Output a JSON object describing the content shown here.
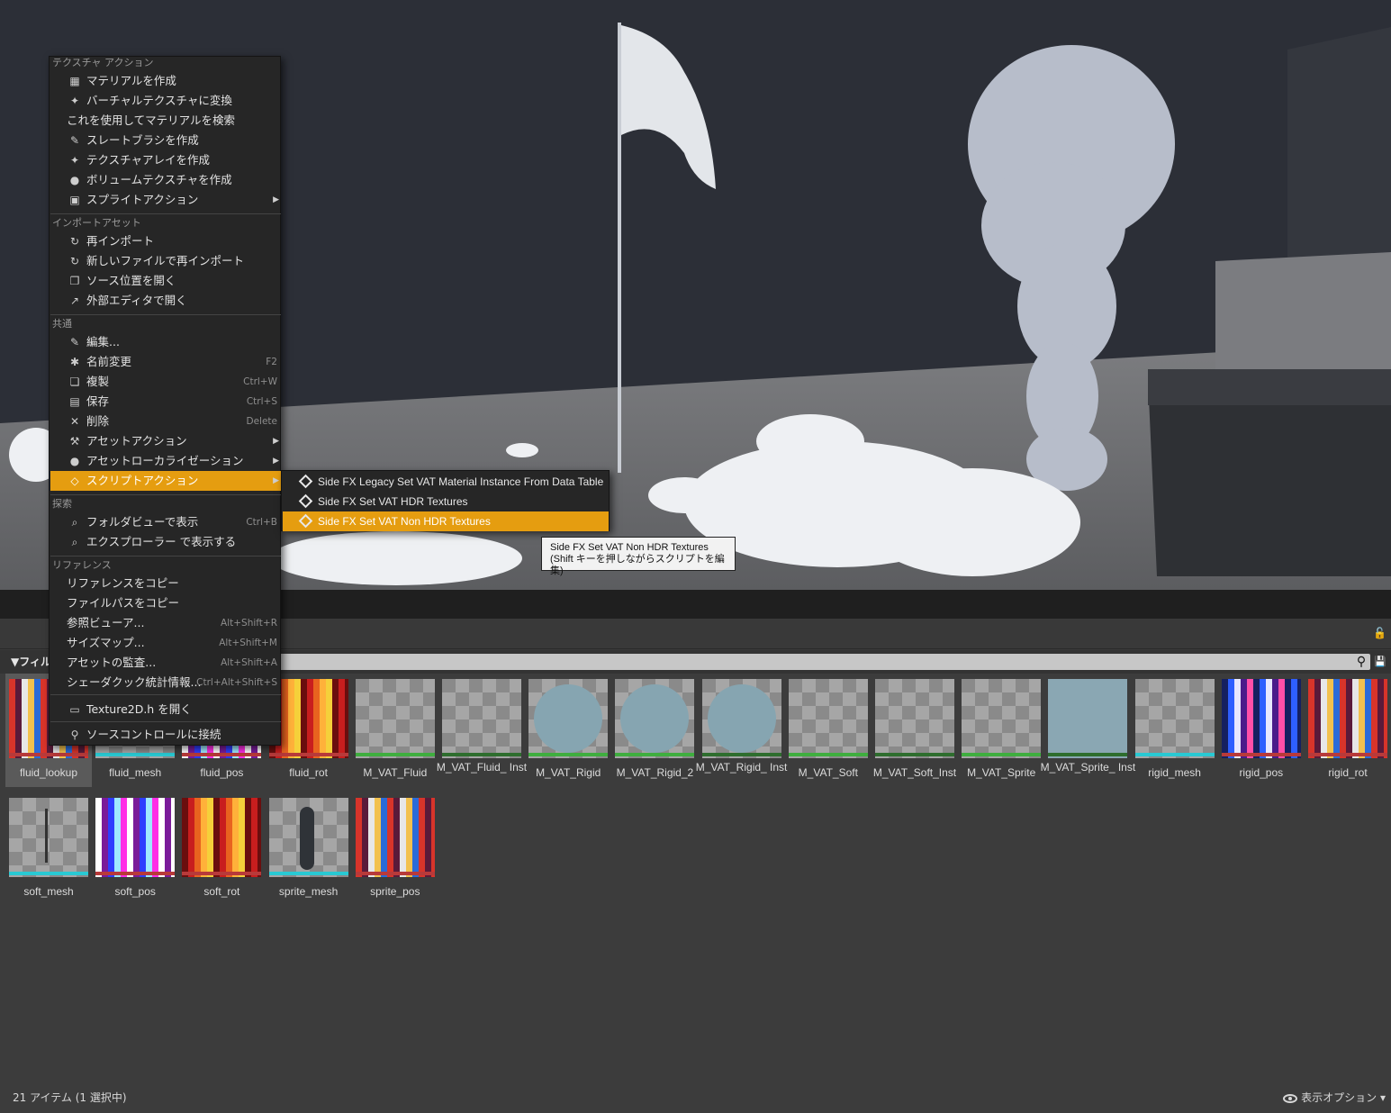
{
  "context_menu": {
    "sections": {
      "texture_actions": "テクスチャ アクション",
      "import_asset": "インポートアセット",
      "common": "共通",
      "explore": "探索",
      "reference": "リファレンス"
    },
    "items": [
      {
        "label": "マテリアルを作成",
        "icon": "material-icon"
      },
      {
        "label": "バーチャルテクスチャに変換",
        "icon": "virtual-texture-icon"
      },
      {
        "label": "これを使用してマテリアルを検索"
      },
      {
        "label": "スレートブラシを作成",
        "icon": "brush-icon"
      },
      {
        "label": "テクスチャアレイを作成",
        "icon": "texture-array-icon"
      },
      {
        "label": "ボリュームテクスチャを作成",
        "icon": "sphere-icon"
      },
      {
        "label": "スプライトアクション",
        "icon": "sprite-icon",
        "submenu": true
      },
      {
        "label": "再インポート",
        "icon": "reimport-icon"
      },
      {
        "label": "新しいファイルで再インポート",
        "icon": "reimport-icon"
      },
      {
        "label": "ソース位置を開く",
        "icon": "folder-open-icon"
      },
      {
        "label": "外部エディタで開く",
        "icon": "external-editor-icon"
      },
      {
        "label": "編集...",
        "icon": "edit-icon"
      },
      {
        "label": "名前変更",
        "icon": "rename-icon",
        "shortcut": "F2"
      },
      {
        "label": "複製",
        "icon": "duplicate-icon",
        "shortcut": "Ctrl+W"
      },
      {
        "label": "保存",
        "icon": "save-icon",
        "shortcut": "Ctrl+S"
      },
      {
        "label": "削除",
        "icon": "delete-icon",
        "shortcut": "Delete"
      },
      {
        "label": "アセットアクション",
        "icon": "wrench-icon",
        "submenu": true
      },
      {
        "label": "アセットローカライゼーション",
        "icon": "globe-icon",
        "submenu": true
      },
      {
        "label": "スクリプトアクション",
        "icon": "script-icon",
        "submenu": true,
        "highlighted": true
      },
      {
        "label": "フォルダビューで表示",
        "icon": "magnifier-icon",
        "shortcut": "Ctrl+B"
      },
      {
        "label": "エクスプローラー で表示する",
        "icon": "magnifier-icon"
      },
      {
        "label": "リファレンスをコピー"
      },
      {
        "label": "ファイルパスをコピー"
      },
      {
        "label": "参照ビューア...",
        "shortcut": "Alt+Shift+R"
      },
      {
        "label": "サイズマップ...",
        "shortcut": "Alt+Shift+M"
      },
      {
        "label": "アセットの監査...",
        "shortcut": "Alt+Shift+A"
      },
      {
        "label": "シェーダクック統計情報...",
        "shortcut": "Ctrl+Alt+Shift+S"
      },
      {
        "label": "Texture2D.h を開く",
        "icon": "code-icon"
      },
      {
        "label": "ソースコントロールに接続",
        "icon": "source-control-icon"
      }
    ]
  },
  "submenu": {
    "items": [
      {
        "label": "Side FX Legacy Set VAT Material Instance From Data Table"
      },
      {
        "label": "Side FX Set VAT HDR Textures"
      },
      {
        "label": "Side FX Set VAT Non HDR Textures",
        "highlighted": true
      }
    ]
  },
  "tooltip": {
    "line1": "Side FX Set VAT Non HDR Textures",
    "line2": "(Shift キーを押しながらスクリプトを編集)"
  },
  "content_browser": {
    "filter_label": "▼フィル",
    "search_placeholder": "",
    "status": "21 アイテム (1 選択中)",
    "view_options": "表示オプション",
    "assets": [
      {
        "name": "fluid_lookup",
        "kind": "texture",
        "bar": "#b83a3a",
        "selected": true
      },
      {
        "name": "fluid_mesh",
        "kind": "mesh",
        "bar": "#29c9d3"
      },
      {
        "name": "fluid_pos",
        "kind": "texture",
        "bar": "#b83a3a"
      },
      {
        "name": "fluid_rot",
        "kind": "texture",
        "bar": "#b83a3a"
      },
      {
        "name": "M_VAT_Fluid",
        "kind": "material",
        "bar": "#3fae3f"
      },
      {
        "name": "M_VAT_Fluid_ Inst",
        "kind": "material",
        "bar": "#2e6e2e"
      },
      {
        "name": "M_VAT_Rigid",
        "kind": "material",
        "bar": "#3fae3f"
      },
      {
        "name": "M_VAT_Rigid_2",
        "kind": "material",
        "bar": "#3fae3f"
      },
      {
        "name": "M_VAT_Rigid_ Inst",
        "kind": "material",
        "bar": "#2e6e2e"
      },
      {
        "name": "M_VAT_Soft",
        "kind": "material",
        "bar": "#3fae3f"
      },
      {
        "name": "M_VAT_Soft_Inst",
        "kind": "material",
        "bar": "#2e6e2e"
      },
      {
        "name": "M_VAT_Sprite",
        "kind": "material",
        "bar": "#3fae3f"
      },
      {
        "name": "M_VAT_Sprite_ Inst",
        "kind": "material",
        "bar": "#2e6e2e"
      },
      {
        "name": "rigid_mesh",
        "kind": "mesh",
        "bar": "#29c9d3"
      },
      {
        "name": "rigid_pos",
        "kind": "texture",
        "bar": "#b83a3a"
      },
      {
        "name": "rigid_rot",
        "kind": "texture",
        "bar": "#b83a3a"
      },
      {
        "name": "soft_mesh",
        "kind": "mesh",
        "bar": "#29c9d3"
      },
      {
        "name": "soft_pos",
        "kind": "texture",
        "bar": "#b83a3a"
      },
      {
        "name": "soft_rot",
        "kind": "texture",
        "bar": "#b83a3a"
      },
      {
        "name": "sprite_mesh",
        "kind": "mesh",
        "bar": "#29c9d3"
      },
      {
        "name": "sprite_pos",
        "kind": "texture",
        "bar": "#b83a3a"
      }
    ]
  },
  "colors": {
    "highlight": "#e59d10",
    "menu_bg": "#262626",
    "panel_bg": "#3c3c3c"
  }
}
